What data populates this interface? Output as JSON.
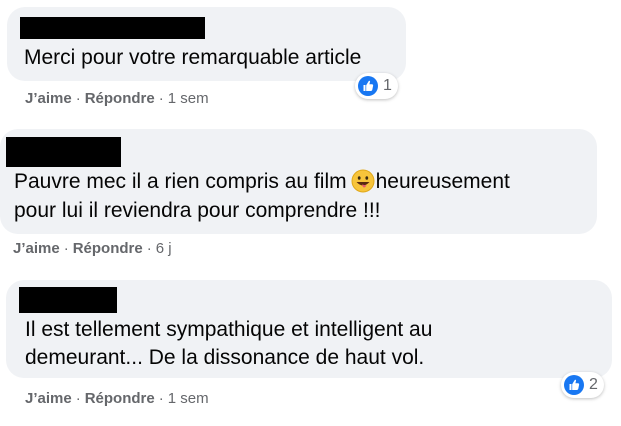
{
  "comments": [
    {
      "text_lines": [
        "Merci pour votre remarquable article"
      ],
      "like_label": "J’aime",
      "reply_label": "Répondre",
      "time": "1 sem",
      "reaction_count": "1",
      "reaction_icon": "like-thumb-icon"
    },
    {
      "text_line1_a": "Pauvre mec il a rien compris au film",
      "text_line1_b": "heureusement",
      "text_line2": "pour lui il reviendra pour comprendre !!!",
      "emoji": "grinning-tongue-emoji",
      "like_label": "J’aime",
      "reply_label": "Répondre",
      "time": "6 j"
    },
    {
      "text_lines": [
        "Il est tellement sympathique et intelligent au",
        "demeurant... De la dissonance de haut vol."
      ],
      "like_label": "J’aime",
      "reply_label": "Répondre",
      "time": "1 sem",
      "reaction_count": "2",
      "reaction_icon": "like-thumb-icon"
    }
  ],
  "colors": {
    "bubble": "#f0f2f5",
    "meta_text": "#65676b",
    "like_blue": "#1877f2",
    "redaction": "#000000"
  }
}
